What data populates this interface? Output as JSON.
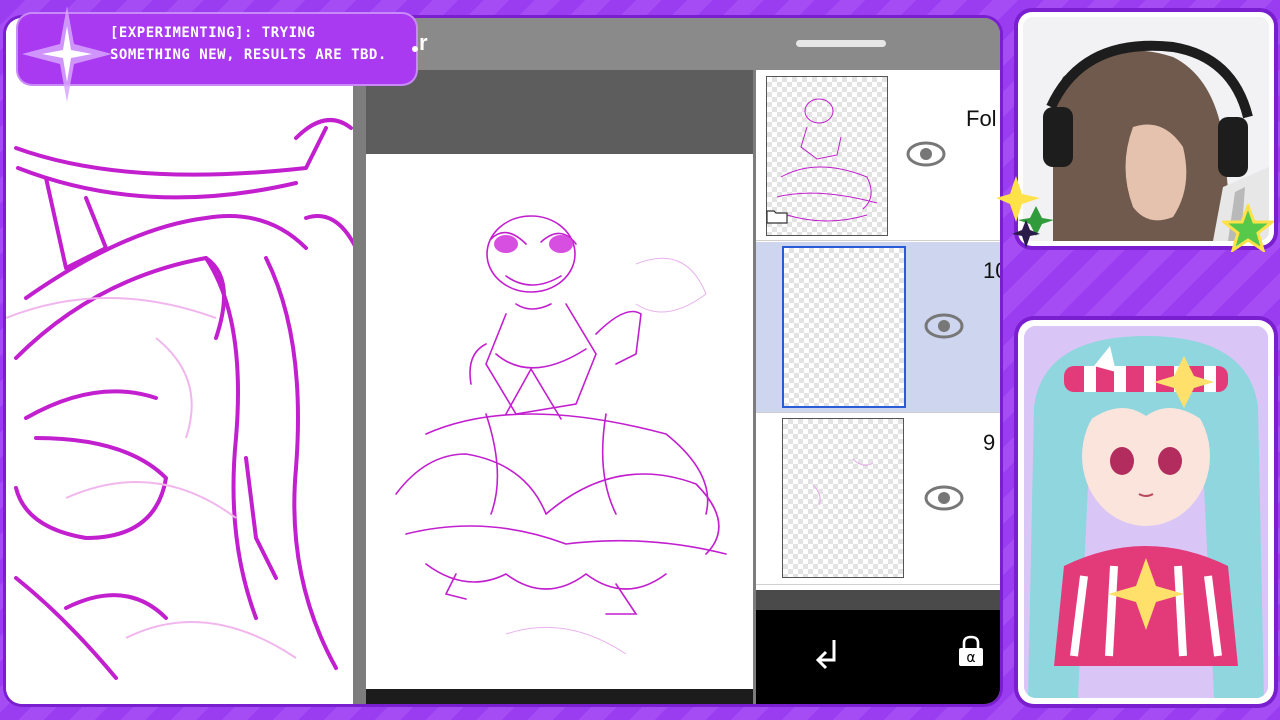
{
  "banner": {
    "text": "[EXPERIMENTING]: TRYING SOMETHING NEW, RESULTS ARE TBD."
  },
  "app": {
    "title_fragment": "r"
  },
  "layers": [
    {
      "name": "Fol",
      "type": "folder",
      "visible": true
    },
    {
      "name": "10",
      "type": "layer",
      "visible": true,
      "selected": true
    },
    {
      "name": "9",
      "type": "layer",
      "visible": true
    }
  ],
  "tools": {
    "move_down_icon": "arrow-down-left-icon",
    "alpha_lock_icon": "alpha-lock-icon"
  },
  "colors": {
    "stream_accent": "#9b3df2",
    "sketch_line": "#c21fcf",
    "selected_layer": "#cdd6ee"
  }
}
